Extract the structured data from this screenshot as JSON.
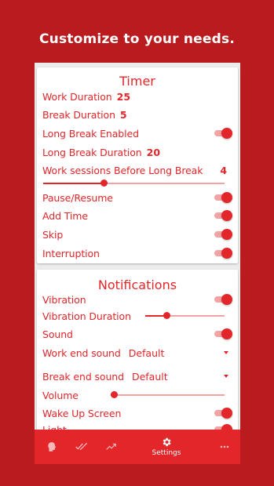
{
  "headline": "Customize to your needs.",
  "timer": {
    "title": "Timer",
    "work_duration": {
      "label": "Work Duration",
      "value": "25"
    },
    "break_duration": {
      "label": "Break Duration",
      "value": "5"
    },
    "long_break_enabled": {
      "label": "Long Break Enabled",
      "on": true
    },
    "long_break_duration": {
      "label": "Long Break Duration",
      "value": "20"
    },
    "sessions_before_long_break": {
      "label": "Work sessions Before Long Break",
      "value": "4",
      "slider_fraction": 0.33
    },
    "pause_resume": {
      "label": "Pause/Resume",
      "on": true
    },
    "add_time": {
      "label": "Add Time",
      "on": true
    },
    "skip": {
      "label": "Skip",
      "on": true
    },
    "interruption": {
      "label": "Interruption",
      "on": true
    }
  },
  "notifications": {
    "title": "Notifications",
    "vibration": {
      "label": "Vibration",
      "on": true
    },
    "vibration_duration": {
      "label": "Vibration Duration",
      "slider_fraction": 0.25
    },
    "sound": {
      "label": "Sound",
      "on": true
    },
    "work_end_sound": {
      "label": "Work end sound",
      "value": "Default"
    },
    "break_end_sound": {
      "label": "Break end sound",
      "value": "Default"
    },
    "volume": {
      "label": "Volume",
      "slider_fraction": 0.0
    },
    "wake_up_screen": {
      "label": "Wake Up Screen",
      "on": true
    },
    "partial_next": {
      "label": "Light"
    }
  },
  "navbar": {
    "items": [
      {
        "icon": "head-icon"
      },
      {
        "icon": "double-check-icon"
      },
      {
        "icon": "trending-up-icon"
      },
      {
        "icon": "gear-icon",
        "label": "Settings",
        "active": true
      },
      {
        "icon": "more-dots-icon"
      }
    ]
  },
  "colors": {
    "background": "#b91b1e",
    "accent": "#e2262a",
    "accent_light": "#f2a3a4"
  }
}
